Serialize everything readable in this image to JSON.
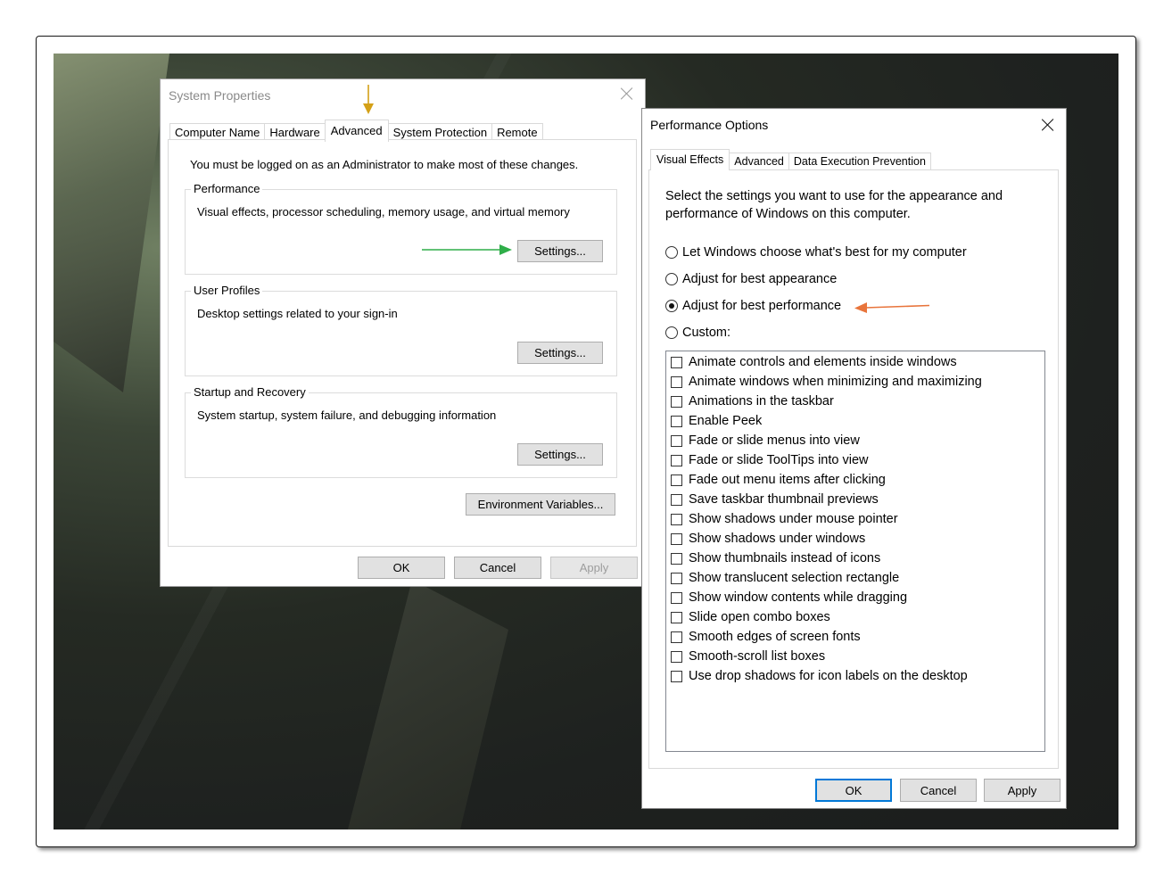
{
  "system_properties": {
    "title": "System Properties",
    "tabs": [
      "Computer Name",
      "Hardware",
      "Advanced",
      "System Protection",
      "Remote"
    ],
    "active_tab": "Advanced",
    "admin_note": "You must be logged on as an Administrator to make most of these changes.",
    "performance": {
      "title": "Performance",
      "description": "Visual effects, processor scheduling, memory usage, and virtual memory",
      "button": "Settings..."
    },
    "user_profiles": {
      "title": "User Profiles",
      "description": "Desktop settings related to your sign-in",
      "button": "Settings..."
    },
    "startup_recovery": {
      "title": "Startup and Recovery",
      "description": "System startup, system failure, and debugging information",
      "button": "Settings..."
    },
    "env_button": "Environment Variables...",
    "ok": "OK",
    "cancel": "Cancel",
    "apply": "Apply"
  },
  "performance_options": {
    "title": "Performance Options",
    "tabs": [
      "Visual Effects",
      "Advanced",
      "Data Execution Prevention"
    ],
    "active_tab": "Visual Effects",
    "intro_line1": "Select the settings you want to use for the appearance and",
    "intro_line2": "performance of Windows on this computer.",
    "radios": [
      {
        "label": "Let Windows choose what's best for my computer",
        "selected": false
      },
      {
        "label": "Adjust for best appearance",
        "selected": false
      },
      {
        "label": "Adjust for best performance",
        "selected": true
      },
      {
        "label": "Custom:",
        "selected": false
      }
    ],
    "checkboxes": [
      {
        "label": "Animate controls and elements inside windows",
        "checked": false
      },
      {
        "label": "Animate windows when minimizing and maximizing",
        "checked": false
      },
      {
        "label": "Animations in the taskbar",
        "checked": false
      },
      {
        "label": "Enable Peek",
        "checked": false
      },
      {
        "label": "Fade or slide menus into view",
        "checked": false
      },
      {
        "label": "Fade or slide ToolTips into view",
        "checked": false
      },
      {
        "label": "Fade out menu items after clicking",
        "checked": false
      },
      {
        "label": "Save taskbar thumbnail previews",
        "checked": false
      },
      {
        "label": "Show shadows under mouse pointer",
        "checked": false
      },
      {
        "label": "Show shadows under windows",
        "checked": false
      },
      {
        "label": "Show thumbnails instead of icons",
        "checked": false
      },
      {
        "label": "Show translucent selection rectangle",
        "checked": false
      },
      {
        "label": "Show window contents while dragging",
        "checked": false
      },
      {
        "label": "Slide open combo boxes",
        "checked": false
      },
      {
        "label": "Smooth edges of screen fonts",
        "checked": false
      },
      {
        "label": "Smooth-scroll list boxes",
        "checked": false
      },
      {
        "label": "Use drop shadows for icon labels on the desktop",
        "checked": false
      }
    ],
    "ok": "OK",
    "cancel": "Cancel",
    "apply": "Apply"
  },
  "annotation_colors": {
    "tab_arrow": "#d4a017",
    "settings_arrow": "#2fae49",
    "performance_arrow": "#e8743b"
  },
  "colors": {
    "default_button_border": "#0078d7",
    "button_face": "#e1e1e1"
  }
}
